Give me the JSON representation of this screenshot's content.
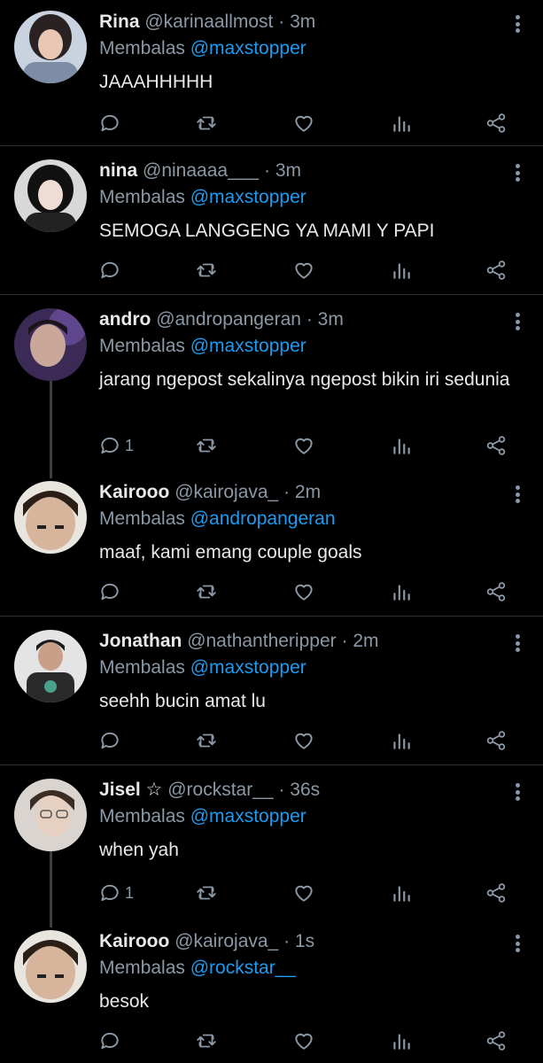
{
  "colors": {
    "background": "#000000",
    "accent": "#1d9bf0",
    "muted": "#8b98a5",
    "text": "#e7e9ea"
  },
  "reply_prefix": "Membalas",
  "tweets": [
    {
      "name": "Rina",
      "handle": "@karinaallmost",
      "time": "3m",
      "reply_to": "@maxstopper",
      "text": "JAAAHHHHH",
      "reply_count": ""
    },
    {
      "name": "nina",
      "handle": "@ninaaaa___",
      "time": "3m",
      "reply_to": "@maxstopper",
      "text": "SEMOGA LANGGENG YA MAMI Y PAPI",
      "reply_count": ""
    },
    {
      "name": "andro",
      "handle": "@andropangeran",
      "time": "3m",
      "reply_to": "@maxstopper",
      "text": "jarang ngepost sekalinya ngepost bikin iri sedunia",
      "reply_count": "1"
    },
    {
      "name": "Kairooo",
      "handle": "@kairojava_",
      "time": "2m",
      "reply_to": "@andropangeran",
      "text": "maaf, kami emang couple goals",
      "reply_count": ""
    },
    {
      "name": "Jonathan",
      "handle": "@nathantheripper",
      "time": "2m",
      "reply_to": "@maxstopper",
      "text": "seehh bucin amat lu",
      "reply_count": ""
    },
    {
      "name": "Jisel ☆",
      "handle": "@rockstar__",
      "time": "36s",
      "reply_to": "@maxstopper",
      "text": "when yah",
      "reply_count": "1"
    },
    {
      "name": "Kairooo",
      "handle": "@kairojava_",
      "time": "1s",
      "reply_to": "@rockstar__",
      "text": "besok",
      "reply_count": ""
    }
  ]
}
